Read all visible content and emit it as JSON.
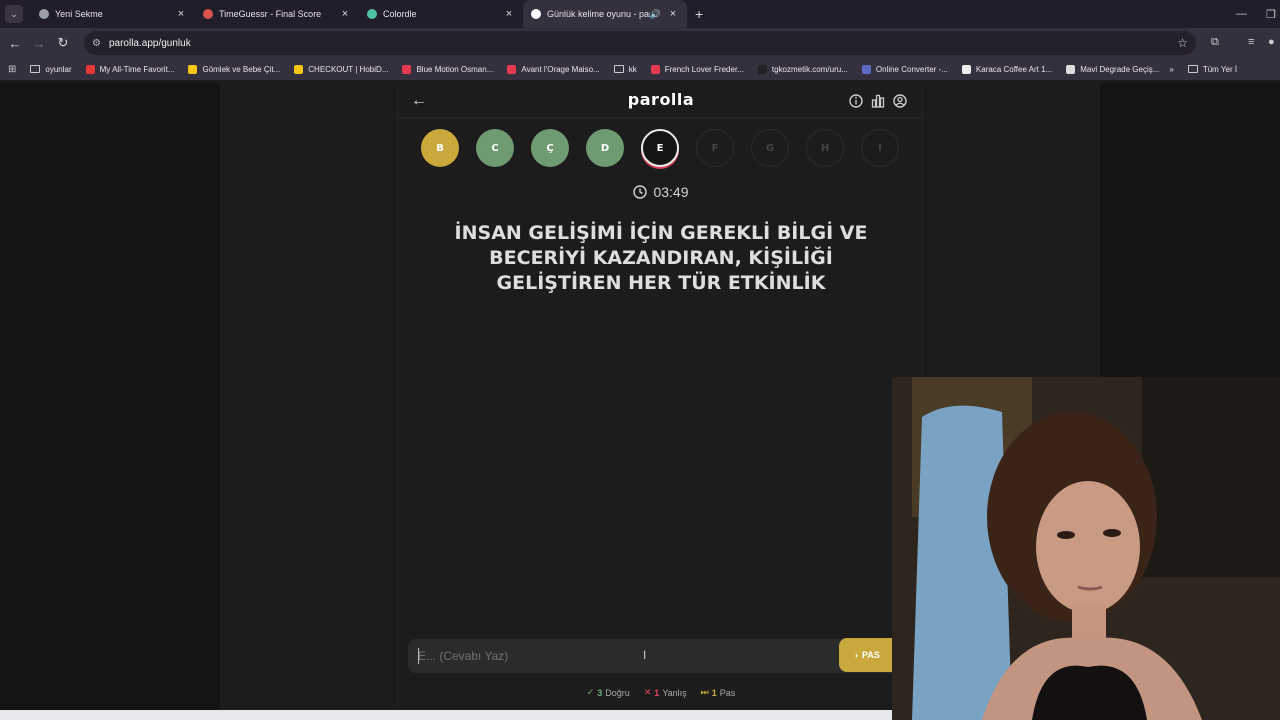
{
  "browser": {
    "tabs": [
      {
        "title": "Yeni Sekme",
        "favicon_color": "#9aa0a6",
        "active": false
      },
      {
        "title": "TimeGuessr - Final Score",
        "favicon_color": "#d9534f",
        "active": false
      },
      {
        "title": "Colordle",
        "favicon_color": "#4fc3a1",
        "active": false
      },
      {
        "title": "Günlük kelime oyunu - parolla",
        "favicon_color": "#ffffff",
        "active": true
      }
    ],
    "url": "parolla.app/gunluk",
    "bookmarks": [
      {
        "label": "oyunlar",
        "type": "folder",
        "color": "#cccccc"
      },
      {
        "label": "My All-Time Favorit...",
        "type": "site",
        "color": "#e53935"
      },
      {
        "label": "Gömlek ve Bebe Çit...",
        "type": "site",
        "color": "#f5c518"
      },
      {
        "label": "CHECKOUT | HobiD...",
        "type": "site",
        "color": "#f5c518"
      },
      {
        "label": "Blue Motion Osman...",
        "type": "site",
        "color": "#e53950"
      },
      {
        "label": "Avant l'Orage Maiso...",
        "type": "site",
        "color": "#e53950"
      },
      {
        "label": "kk",
        "type": "folder",
        "color": "#cccccc"
      },
      {
        "label": "French Lover Freder...",
        "type": "site",
        "color": "#e53950"
      },
      {
        "label": "tgkozmetik.com/uru...",
        "type": "site",
        "color": "#222222"
      },
      {
        "label": "Online Converter -...",
        "type": "site",
        "color": "#5c6bc0"
      },
      {
        "label": "Karaca Coffee Art 1...",
        "type": "site",
        "color": "#eeeeee"
      },
      {
        "label": "Mavi Degrade Geçiş...",
        "type": "site",
        "color": "#dddddd"
      }
    ],
    "all_bookmarks": "Tüm Yer İ"
  },
  "game": {
    "logo": "parolla",
    "letters": [
      {
        "char": "B",
        "state": "yellow"
      },
      {
        "char": "C",
        "state": "green"
      },
      {
        "char": "Ç",
        "state": "green"
      },
      {
        "char": "D",
        "state": "green"
      },
      {
        "char": "E",
        "state": "current"
      },
      {
        "char": "F",
        "state": "pending"
      },
      {
        "char": "G",
        "state": "pending"
      },
      {
        "char": "H",
        "state": "pending"
      },
      {
        "char": "İ",
        "state": "pending"
      }
    ],
    "timer": "03:49",
    "question": "İNSAN GELİŞİMİ İÇİN GEREKLİ BİLGİ VE BECERİYİ KAZANDIRAN, KİŞİLİĞİ GELİŞTİREN HER TÜR ETKİNLİK",
    "answer_placeholder": "E... (Cevabı Yaz)",
    "answer_value": "",
    "pass_label": "PAS",
    "stats": {
      "correct_count": "3",
      "correct_label": "Doğru",
      "wrong_count": "1",
      "wrong_label": "Yanlış",
      "pass_count": "1",
      "pass_label": "Pas"
    }
  },
  "colors": {
    "accent_yellow": "#c9a93c",
    "accent_green": "#6f9b73",
    "accent_red": "#e0475b"
  }
}
